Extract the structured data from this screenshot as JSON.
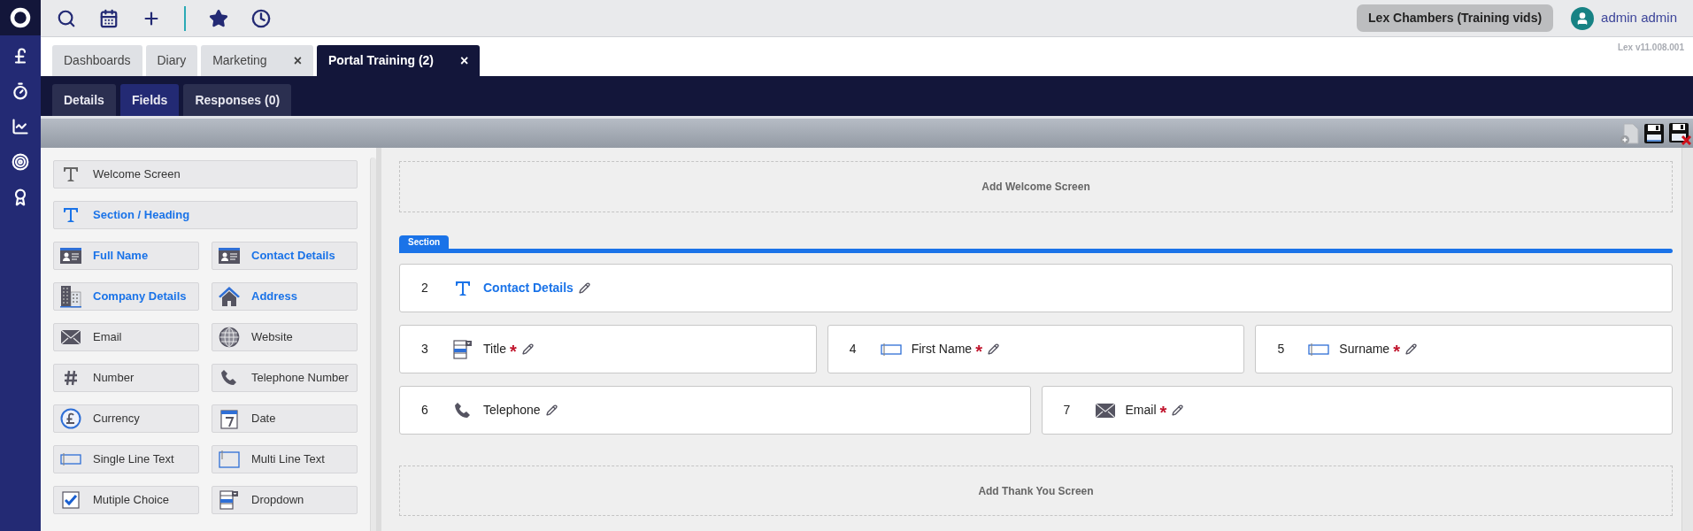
{
  "top_bar": {
    "firm": "Lex Chambers (Training vids)",
    "user": "admin admin"
  },
  "version": "Lex v11.008.001",
  "tabs": [
    {
      "label": "Dashboards",
      "selected": false,
      "closable": false
    },
    {
      "label": "Diary",
      "selected": false,
      "closable": false
    },
    {
      "label": "Marketing",
      "selected": false,
      "closable": true,
      "close": "×"
    },
    {
      "label": "Portal Training (2)",
      "selected": true,
      "closable": true,
      "close": "×"
    }
  ],
  "sub_tabs": [
    {
      "label": "Details",
      "selected": false
    },
    {
      "label": "Fields",
      "selected": true
    },
    {
      "label": "Responses (0)",
      "selected": false
    }
  ],
  "palette": {
    "wide": [
      {
        "label": "Welcome Screen",
        "kind": "text",
        "highlighted": false
      },
      {
        "label": "Section / Heading",
        "kind": "heading",
        "highlighted": true
      }
    ],
    "grid": [
      {
        "label": "Full Name",
        "kind": "card",
        "highlighted": true
      },
      {
        "label": "Contact Details",
        "kind": "card",
        "highlighted": true
      },
      {
        "label": "Company Details",
        "kind": "building",
        "highlighted": true
      },
      {
        "label": "Address",
        "kind": "house",
        "highlighted": true
      },
      {
        "label": "Email",
        "kind": "envelope",
        "highlighted": false
      },
      {
        "label": "Website",
        "kind": "globe",
        "highlighted": false
      },
      {
        "label": "Number",
        "kind": "hash",
        "highlighted": false
      },
      {
        "label": "Telephone Number",
        "kind": "phone",
        "highlighted": false
      },
      {
        "label": "Currency",
        "kind": "pound",
        "highlighted": false
      },
      {
        "label": "Date",
        "kind": "calendar",
        "highlighted": false
      },
      {
        "label": "Single Line Text",
        "kind": "input",
        "highlighted": false
      },
      {
        "label": "Multi Line Text",
        "kind": "textarea",
        "highlighted": false
      },
      {
        "label": "Mutiple Choice",
        "kind": "checkbox",
        "highlighted": false
      },
      {
        "label": "Dropdown",
        "kind": "dropdown",
        "highlighted": false
      }
    ]
  },
  "canvas": {
    "welcome": "Add Welcome Screen",
    "section_label": "Section",
    "rows": [
      [
        {
          "number": "2",
          "label": "Contact Details",
          "kind": "heading",
          "required": false
        }
      ],
      [
        {
          "number": "3",
          "label": "Title",
          "kind": "dropdown",
          "required": true
        },
        {
          "number": "4",
          "label": "First Name",
          "kind": "input",
          "required": true
        },
        {
          "number": "5",
          "label": "Surname",
          "kind": "input",
          "required": true
        }
      ],
      [
        {
          "number": "6",
          "label": "Telephone",
          "kind": "phone",
          "required": false
        },
        {
          "number": "7",
          "label": "Email",
          "kind": "envelope",
          "required": true
        }
      ]
    ],
    "required_mark": "*",
    "thank_you": "Add Thank You Screen"
  }
}
